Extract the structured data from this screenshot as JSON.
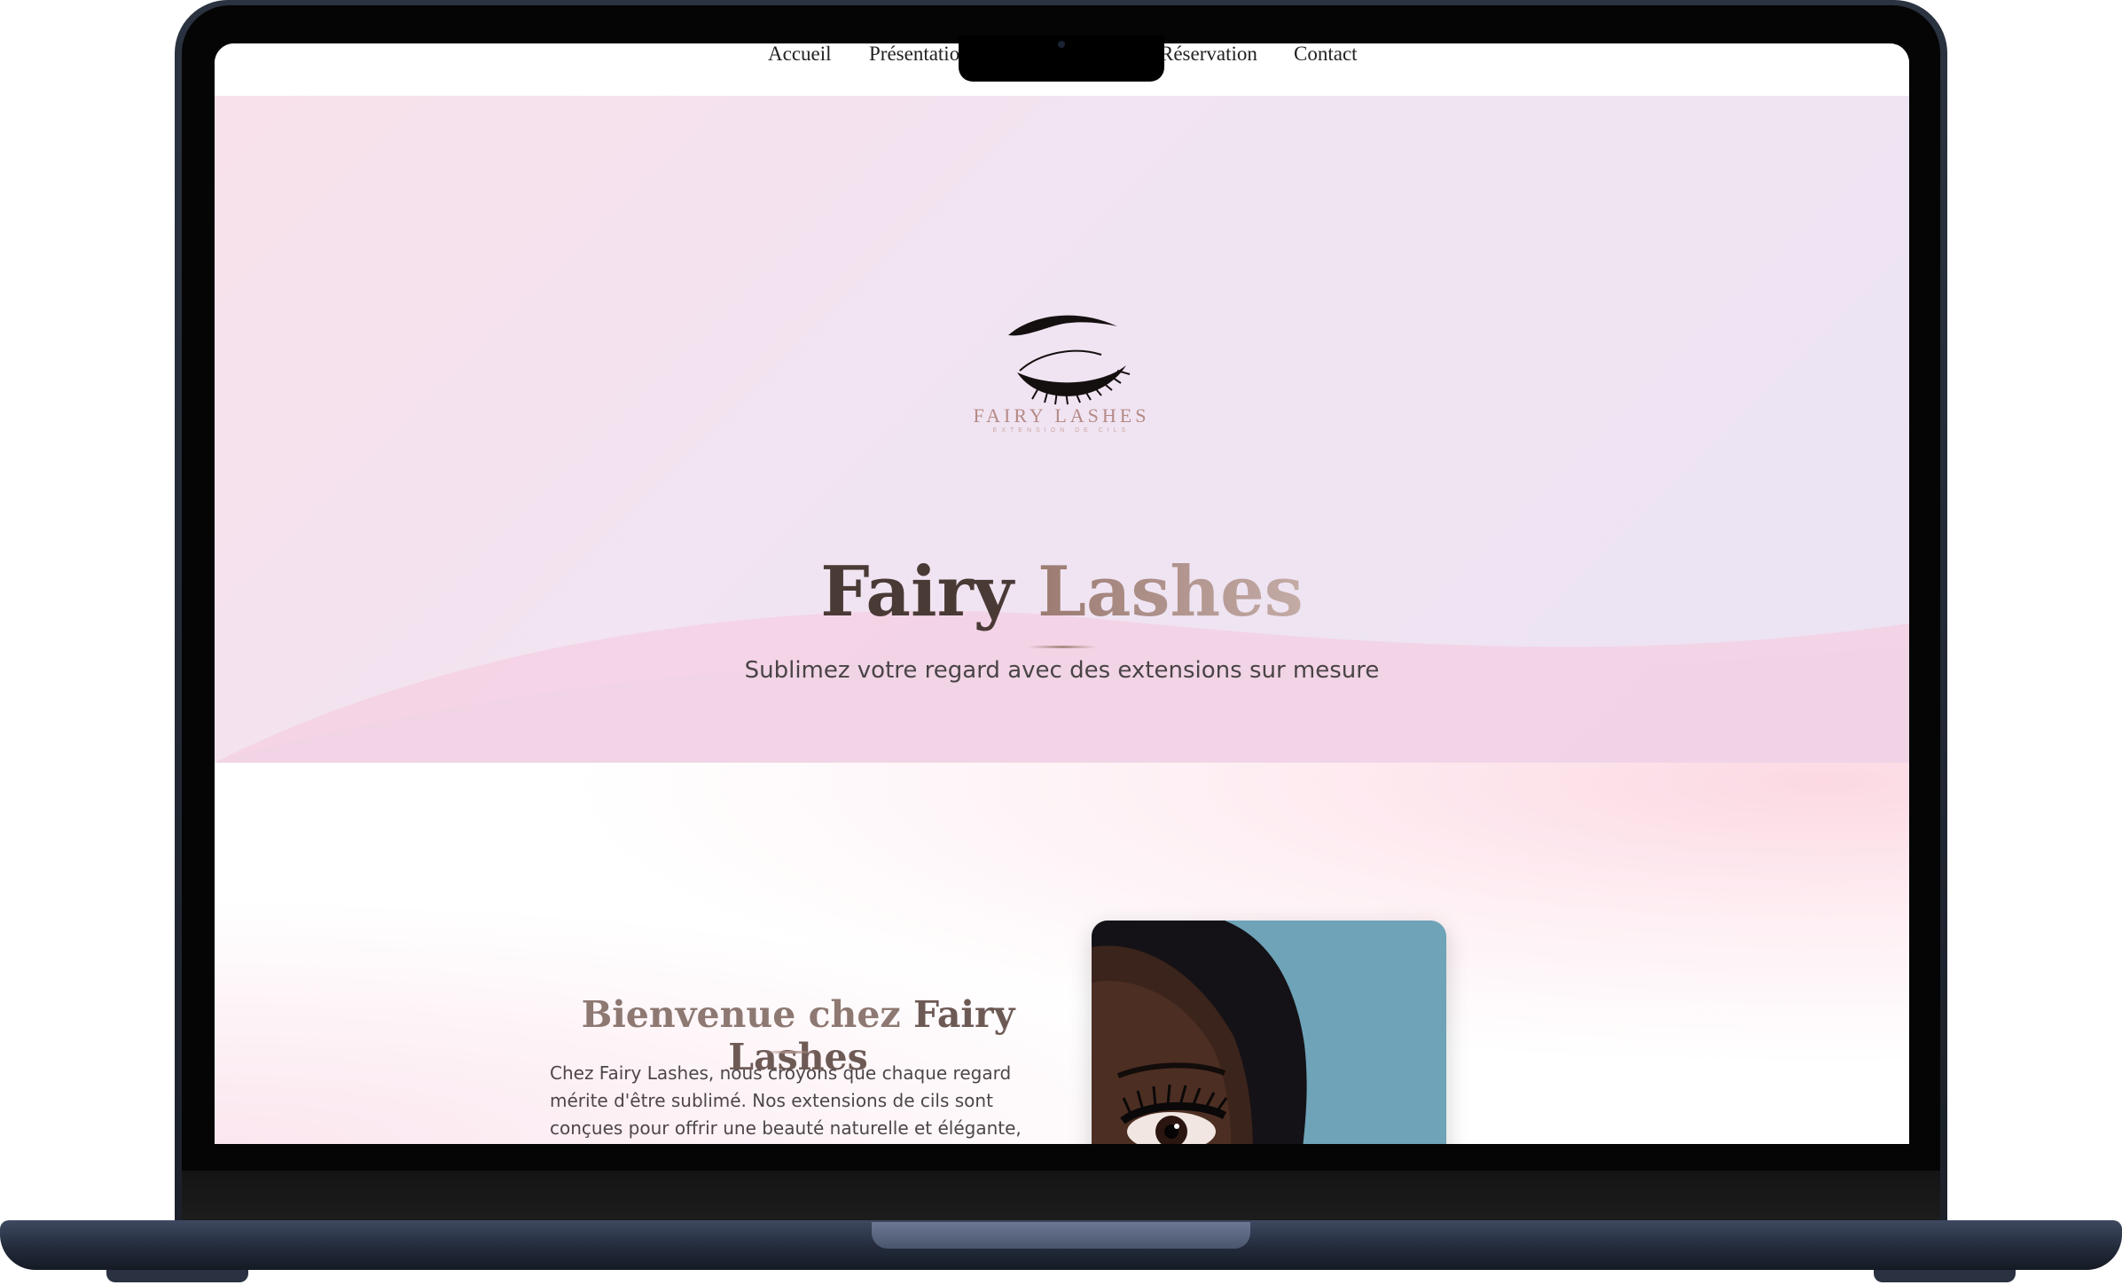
{
  "nav": {
    "items": [
      {
        "label": "Accueil"
      },
      {
        "label": "Présentatio"
      },
      {
        "label": "Réservation"
      },
      {
        "label": "Contact"
      }
    ]
  },
  "hero": {
    "logo_text": "FAIRY LASHES",
    "logo_subtext": "EXTENSION DE CILS",
    "title_part1": "Fairy",
    "title_part2": "Lashes",
    "subtitle": "Sublimez votre regard avec des extensions sur mesure"
  },
  "welcome": {
    "title_part1": "Bienvenue chez",
    "title_part2": "Fairy Lashes",
    "body": "Chez Fairy Lashes, nous croyons que chaque regard mérite d'être sublimé. Nos extensions de cils sont conçues pour offrir une beauté naturelle et élégante,"
  },
  "icons": {
    "logo": "eye-lashes-logo-icon",
    "camera": "webcam-icon"
  },
  "colors": {
    "hero_start": "#f8e1ea",
    "hero_end": "#ebe3f3",
    "title_dark": "#4a3a36",
    "title_light": "#c4aba6",
    "photo_bg": "#6f9fb3"
  }
}
